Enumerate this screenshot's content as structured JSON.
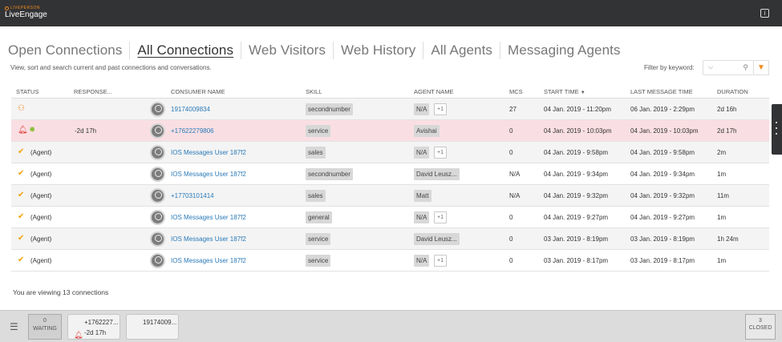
{
  "app": {
    "brand_top": "LIVEPERSON",
    "brand_main": "LiveEngage",
    "help_icon": "info-icon"
  },
  "tabs": [
    {
      "label": "Open Connections",
      "active": false
    },
    {
      "label": "All Connections",
      "active": true
    },
    {
      "label": "Web Visitors",
      "active": false
    },
    {
      "label": "Web History",
      "active": false
    },
    {
      "label": "All Agents",
      "active": false
    },
    {
      "label": "Messaging Agents",
      "active": false
    }
  ],
  "subtitle": "View, sort and search current and past connections and conversations.",
  "filter": {
    "label": "Filter by keyword:",
    "value": ""
  },
  "columns": {
    "status": "STATUS",
    "response": "RESPONSE...",
    "consumer": "CONSUMER NAME",
    "skill": "SKILL",
    "agent": "AGENT NAME",
    "mcs": "MCS",
    "start": "START TIME",
    "last": "LAST MESSAGE TIME",
    "duration": "DURATION"
  },
  "rows": [
    {
      "status_icons": [
        "person-icon"
      ],
      "status_text": "",
      "response": "",
      "consumer": "19174009834",
      "skill": "secondnumber",
      "agent": "N/A",
      "agent_extra": "+1",
      "mcs": "27",
      "start": "04 Jan. 2019 - 11:20pm",
      "last": "06 Jan. 2019 - 2:29pm",
      "duration": "2d 16h"
    },
    {
      "status_icons": [
        "bell-icon",
        "gear-icon"
      ],
      "status_text": "",
      "response": "-2d 17h",
      "consumer": "+17622279806",
      "skill": "service",
      "agent": "Avishai",
      "agent_extra": "",
      "mcs": "0",
      "start": "04 Jan. 2019 - 10:03pm",
      "last": "04 Jan. 2019 - 10:03pm",
      "duration": "2d 17h"
    },
    {
      "status_icons": [
        "check-icon"
      ],
      "status_text": "(Agent)",
      "response": "",
      "consumer": "IOS Messages User 187f2",
      "skill": "sales",
      "agent": "N/A",
      "agent_extra": "+1",
      "mcs": "0",
      "start": "04 Jan. 2019 - 9:58pm",
      "last": "04 Jan. 2019 - 9:58pm",
      "duration": "2m"
    },
    {
      "status_icons": [
        "check-icon"
      ],
      "status_text": "(Agent)",
      "response": "",
      "consumer": "IOS Messages User 187f2",
      "skill": "secondnumber",
      "agent": "David Leusz...",
      "agent_extra": "",
      "mcs": "N/A",
      "start": "04 Jan. 2019 - 9:34pm",
      "last": "04 Jan. 2019 - 9:34pm",
      "duration": "1m"
    },
    {
      "status_icons": [
        "check-icon"
      ],
      "status_text": "(Agent)",
      "response": "",
      "consumer": "+17703101414",
      "skill": "sales",
      "agent": "Matt",
      "agent_extra": "",
      "mcs": "N/A",
      "start": "04 Jan. 2019 - 9:32pm",
      "last": "04 Jan. 2019 - 9:32pm",
      "duration": "11m"
    },
    {
      "status_icons": [
        "check-icon"
      ],
      "status_text": "(Agent)",
      "response": "",
      "consumer": "IOS Messages User 187f2",
      "skill": "general",
      "agent": "N/A",
      "agent_extra": "+1",
      "mcs": "0",
      "start": "04 Jan. 2019 - 9:27pm",
      "last": "04 Jan. 2019 - 9:27pm",
      "duration": "1m"
    },
    {
      "status_icons": [
        "check-icon"
      ],
      "status_text": "(Agent)",
      "response": "",
      "consumer": "IOS Messages User 187f2",
      "skill": "service",
      "agent": "David Leusz...",
      "agent_extra": "",
      "mcs": "0",
      "start": "03 Jan. 2019 - 8:19pm",
      "last": "03 Jan. 2019 - 8:19pm",
      "duration": "1h 24m"
    },
    {
      "status_icons": [
        "check-icon"
      ],
      "status_text": "(Agent)",
      "response": "",
      "consumer": "IOS Messages User 187f2",
      "skill": "service",
      "agent": "N/A",
      "agent_extra": "+1",
      "mcs": "0",
      "start": "03 Jan. 2019 - 8:17pm",
      "last": "03 Jan. 2019 - 8:17pm",
      "duration": "1m"
    }
  ],
  "footer_text": "You are viewing 13 connections",
  "bottom": {
    "waiting_count": "0",
    "waiting_label": "WAITING",
    "cards": [
      {
        "name": "+1762227...",
        "sub": "-2d 17h",
        "alert": true
      },
      {
        "name": "19174009...",
        "sub": "",
        "alert": false
      }
    ],
    "closed_count": "3",
    "closed_label": "CLOSED"
  }
}
